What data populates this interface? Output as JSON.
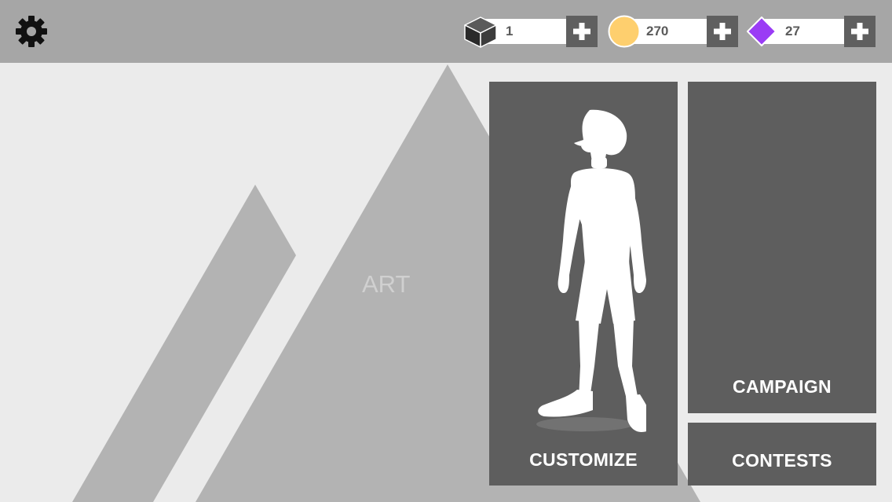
{
  "topbar": {
    "settings_icon": "gear-icon",
    "crates": {
      "icon": "cube-icon",
      "value": "1",
      "add_icon": "plus-icon"
    },
    "coins": {
      "icon": "coin-icon",
      "value": "270",
      "color": "#fecf6e",
      "add_icon": "plus-icon"
    },
    "gems": {
      "icon": "gem-icon",
      "value": "27",
      "color": "#9a3cf5",
      "add_icon": "plus-icon"
    }
  },
  "background": {
    "art_label": "ART"
  },
  "menu": {
    "customize_label": "CUSTOMIZE",
    "campaign_label": "CAMPAIGN",
    "contests_label": "CONTESTS"
  }
}
